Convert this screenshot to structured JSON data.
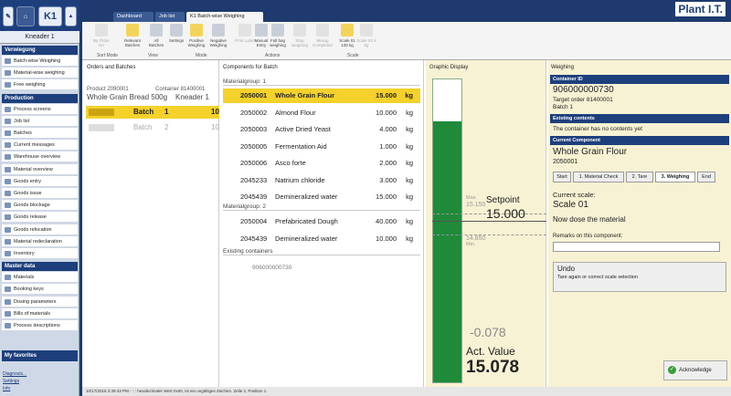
{
  "sidebar": {
    "top_label": "K1",
    "title": "Kneader 1",
    "sections": [
      {
        "title": "Verwiegung",
        "items": [
          "Batch-wise Weighing",
          "Material-wise weighing",
          "Free weighing"
        ]
      },
      {
        "title": "Production",
        "items": [
          "Process screens",
          "Job list",
          "Batches",
          "Current messages",
          "Warehouse overview",
          "Material overview",
          "Goods entry",
          "Goods issue",
          "Goods blockage",
          "Goods release",
          "Goods relocation",
          "Material redeclaration",
          "Inventory"
        ]
      },
      {
        "title": "Master data",
        "items": [
          "Materials",
          "Booking keys",
          "Dosing parameters",
          "Bills of materials",
          "Process descriptions"
        ]
      }
    ],
    "favorites": "My favorites",
    "links": [
      "Diagnosis...",
      "Settings",
      "Info"
    ]
  },
  "tabs": [
    {
      "label": "Dashboard"
    },
    {
      "label": "Job list"
    },
    {
      "label": "K1 Batch-wise Weighing"
    }
  ],
  "logo": "Plant I.T.",
  "toolbar": {
    "buttons": [
      {
        "label": "By Order No",
        "state": "disabled"
      },
      {
        "label": "Relevant Batches",
        "state": "on"
      },
      {
        "label": "All Batches",
        "state": "normal"
      },
      {
        "label": "Settings",
        "state": "normal"
      },
      {
        "label": "Positive Weighing",
        "state": "on"
      },
      {
        "label": "Negative Weighing",
        "state": "normal"
      },
      {
        "label": "Print Label",
        "state": "disabled"
      },
      {
        "label": "Manual Entry",
        "state": "normal"
      },
      {
        "label": "Full bag weighing",
        "state": "normal"
      },
      {
        "label": "Stop weighing",
        "state": "disabled"
      },
      {
        "label": "Mixing Completed",
        "state": "disabled"
      },
      {
        "label": "Scale 01 125 kg",
        "state": "on"
      },
      {
        "label": "Scale 02 5 kg",
        "state": "disabled"
      }
    ],
    "groups": [
      "Sort Mode",
      "View",
      "Mode",
      "Actions",
      "Scale"
    ]
  },
  "orders": {
    "heading": "Orders and Batches",
    "product_line": "Product 2090001",
    "container_line": "Container 81400001",
    "product_name": "Whole Grain Bread 500g",
    "container_name": "Kneader 1",
    "batches": [
      {
        "label": "Batch",
        "no": "1",
        "extra": "10",
        "selected": true
      },
      {
        "label": "Batch",
        "no": "2",
        "extra": "10",
        "selected": false
      }
    ]
  },
  "components": {
    "heading": "Components for Batch",
    "group1": "Materialgroup: 1",
    "group1_rows": [
      {
        "code": "2050001",
        "name": "Whole Grain Flour",
        "qty": "15.000",
        "unit": "kg",
        "selected": true
      },
      {
        "code": "2050002",
        "name": "Almond Flour",
        "qty": "10.000",
        "unit": "kg"
      },
      {
        "code": "2050003",
        "name": "Active Dried Yeast",
        "qty": "4.000",
        "unit": "kg"
      },
      {
        "code": "2050005",
        "name": "Fermentation Aid",
        "qty": "1.000",
        "unit": "kg"
      },
      {
        "code": "2050006",
        "name": "Asco forte",
        "qty": "2.000",
        "unit": "kg"
      },
      {
        "code": "2045233",
        "name": "Natrium chloride",
        "qty": "3.000",
        "unit": "kg"
      },
      {
        "code": "2045439",
        "name": "Demineralized water",
        "qty": "15.000",
        "unit": "kg"
      }
    ],
    "group2": "Materialgroup: 2",
    "group2_rows": [
      {
        "code": "2050004",
        "name": "Prefabricated Dough",
        "qty": "40.000",
        "unit": "kg"
      },
      {
        "code": "2045439",
        "name": "Demineralized water",
        "qty": "10.000",
        "unit": "kg"
      }
    ],
    "existing_heading": "Existing containers",
    "existing_value": "906000000730"
  },
  "graphic": {
    "heading": "Graphic Display",
    "max_label": "Max.",
    "max_value": "15.150",
    "min_label": "Min.",
    "min_value": "14.850",
    "setpoint_label": "Setpoint",
    "setpoint_value": "15.000",
    "deviation": "-0.078",
    "actual_label": "Act. Value",
    "actual_value": "15.078",
    "fill_fraction": 0.86
  },
  "weighing": {
    "heading": "Weighing",
    "container_id_h": "Container ID",
    "container_id": "906000000730",
    "target_order": "Target order 81400001",
    "batch": "Batch 1",
    "existing_h": "Existing contents",
    "existing_text": "The container has no contents yet",
    "current_h": "Current Component",
    "component_name": "Whole Grain Flour",
    "component_code": "2050001",
    "steps": [
      "Start",
      "1. Material Check",
      "2. Tare",
      "3. Weighing",
      "End"
    ],
    "current_scale_label": "Current scale:",
    "current_scale": "Scale 01",
    "instruction": "Now dose the material",
    "remarks_label": "Remarks on this component:",
    "remarks_value": "",
    "undo_title": "Undo",
    "undo_text": "Tare again or correct scale selection",
    "acknowledge": "Acknowledge"
  },
  "statusbar": "10/17/2016 2:39:43 PM - '..' hexidezimaler Wert 0x00, ist ein ungültiges Zeichen. Zeile 2, Position 1."
}
